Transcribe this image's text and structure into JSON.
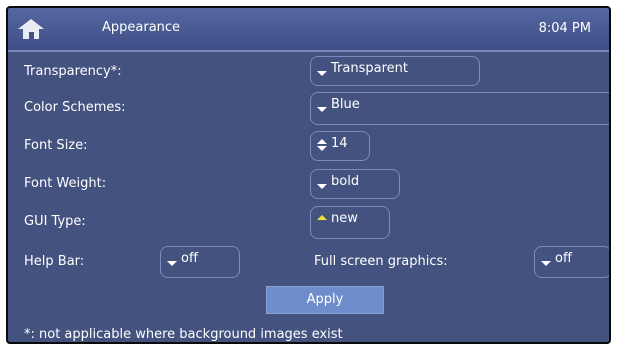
{
  "header": {
    "title": "Appearance",
    "time": "8:04 PM",
    "home_icon": "house-icon"
  },
  "settings": {
    "transparency": {
      "label": "Transparency*:",
      "value": "Transparent"
    },
    "color_schemes": {
      "label": "Color Schemes:",
      "value": "Blue"
    },
    "font_size": {
      "label": "Font Size:",
      "value": "14"
    },
    "font_weight": {
      "label": "Font Weight:",
      "value": "bold"
    },
    "gui_type": {
      "label": "GUI Type:",
      "value": "new"
    },
    "help_bar": {
      "label": "Help Bar:",
      "value": "off"
    },
    "full_screen_graphics": {
      "label": "Full screen graphics:",
      "value": "off"
    }
  },
  "apply_label": "Apply",
  "footnote": "*: not applicable where background images exist",
  "colors": {
    "background": "#44527f",
    "button": "#6f8ccc",
    "highlight_arrow": "#f2e23a"
  }
}
